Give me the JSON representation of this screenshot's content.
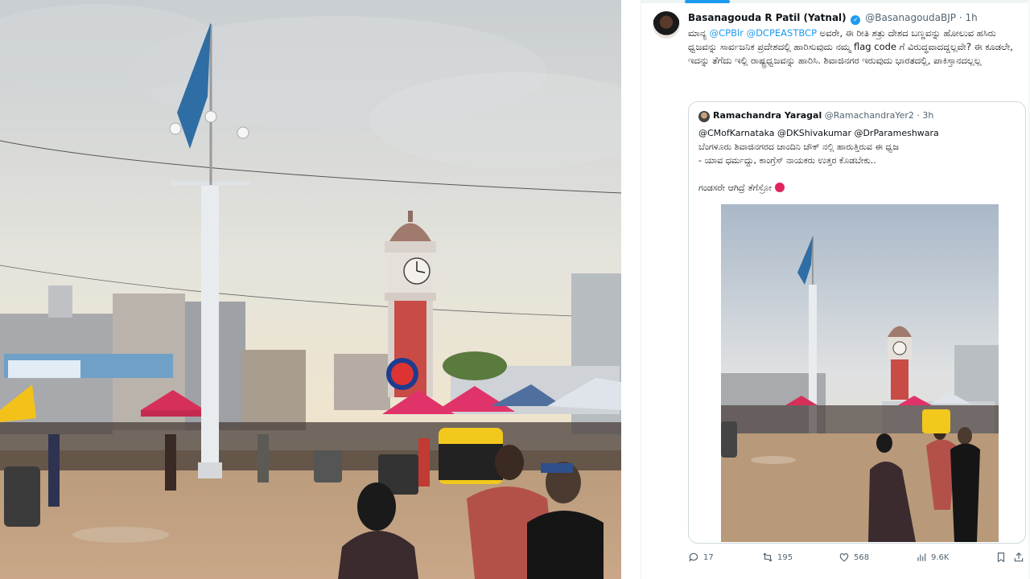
{
  "tweet": {
    "author_name": "Basanagouda R Patil (Yatnal)",
    "author_handle": "@BasanagoudaBJP",
    "separator": "·",
    "time": "1h",
    "verified_icon": "verified-badge-icon",
    "text_prefix": "ಮಾನ್ಯ ",
    "mentions": [
      "@CPBlr",
      "@DCPEASTBCP"
    ],
    "text_after_mentions": " ಅವರೇ, ಈ ರೀತಿ ಶತ್ರು ದೇಶದ ಬಣ್ಣವನ್ನು ಹೋಲುವ ಹಸಿರು ಧ್ವಜವನ್ನು ಸಾರ್ವಜನಿಕ ಪ್ರದೇಶದಲ್ಲಿ ಹಾರಿಸುವುದು ನಮ್ಮ flag code ಗೆ ವಿರುದ್ಧವಾದದ್ದಲ್ಲವೇ? ಈ ಕೂಡಲೇ, ಇದನ್ನು ತೆಗೆದು ಇಲ್ಲಿ ರಾಷ್ಟ್ರಧ್ವಜವನ್ನು ಹಾರಿಸಿ. ಶಿವಾಜಿನಗರ ಇರುವುದು ಭಾರತದಲ್ಲಿ, ಪಾಕಿಸ್ತಾನದಲ್ಲಲ್ಲ"
  },
  "quote": {
    "author_name": "Ramachandra Yaragal",
    "author_handle": "@RamachandraYer2",
    "separator": "·",
    "time": "3h",
    "mentions_line": "@CMofKarnataka @DKShivakumar @DrParameshwara",
    "line2": "ಬೆಂಗಳೂರು ಶಿವಾಜಿನಗರದ ಚಾಂದಿನಿ ಚೌಕ್ ನಲ್ಲಿ ಹಾರುತ್ತಿರುವ ಈ ಧ್ವಜ",
    "line3": "- ಯಾವ ಧರ್ಮದ್ದು, ಕಾಂಗ್ರೆಸ್ ನಾಯಕರು ಉತ್ತರ ಕೊಡಬೇಕು..",
    "line4": "ಗಂಡಸರೇ ಆಗಿದ್ರೆ ತೆಗೆಸ್ರೋ",
    "emoji_icon": "angry-face-icon"
  },
  "actions": {
    "replies": "17",
    "retweets": "195",
    "likes": "568",
    "views": "9.6K"
  },
  "colors": {
    "accent": "#1d9bf0",
    "text": "#0f1419",
    "muted": "#536471",
    "border": "#cfd9de"
  }
}
